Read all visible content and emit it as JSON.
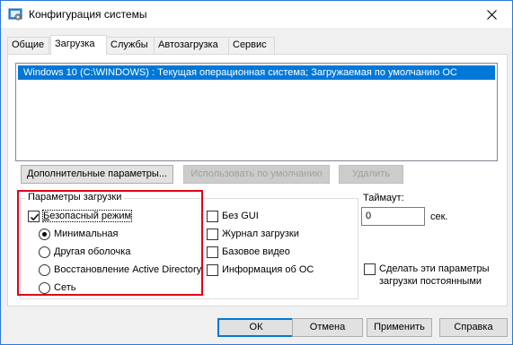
{
  "window": {
    "title": "Конфигурация системы",
    "icon": "msconfig-icon",
    "close_icon": "close-icon"
  },
  "tabs": [
    {
      "label": "Общие"
    },
    {
      "label": "Загрузка",
      "active": true
    },
    {
      "label": "Службы"
    },
    {
      "label": "Автозагрузка"
    },
    {
      "label": "Сервис"
    }
  ],
  "os_list": {
    "items": [
      "Windows 10 (C:\\WINDOWS) : Текущая операционная система; Загружаемая по умолчанию ОС"
    ],
    "selected_index": 0
  },
  "buttons": {
    "advanced": "Дополнительные параметры...",
    "set_default": "Использовать по умолчанию",
    "delete": "Удалить"
  },
  "boot_options": {
    "title": "Параметры загрузки",
    "safe_boot": {
      "label": "Безопасный режим",
      "checked": true
    },
    "radios": [
      {
        "label": "Минимальная",
        "selected": true
      },
      {
        "label": "Другая оболочка",
        "selected": false
      },
      {
        "label": "Восстановление Active Directory",
        "selected": false
      },
      {
        "label": "Сеть",
        "selected": false
      }
    ],
    "checks": [
      {
        "label": "Без GUI",
        "checked": false
      },
      {
        "label": "Журнал загрузки",
        "checked": false
      },
      {
        "label": "Базовое видео",
        "checked": false
      },
      {
        "label": "Информация  об ОС",
        "checked": false
      }
    ]
  },
  "timeout": {
    "label": "Таймаут:",
    "value": "0",
    "unit": "сек."
  },
  "permanent": {
    "label": "Сделать эти параметры загрузки постоянными",
    "checked": false
  },
  "footer": {
    "ok": "ОК",
    "cancel": "Отмена",
    "apply": "Применить",
    "help": "Справка"
  },
  "colors": {
    "accent": "#0078d7",
    "highlight_border": "#e3001b",
    "window_border": "#2b79d7"
  }
}
